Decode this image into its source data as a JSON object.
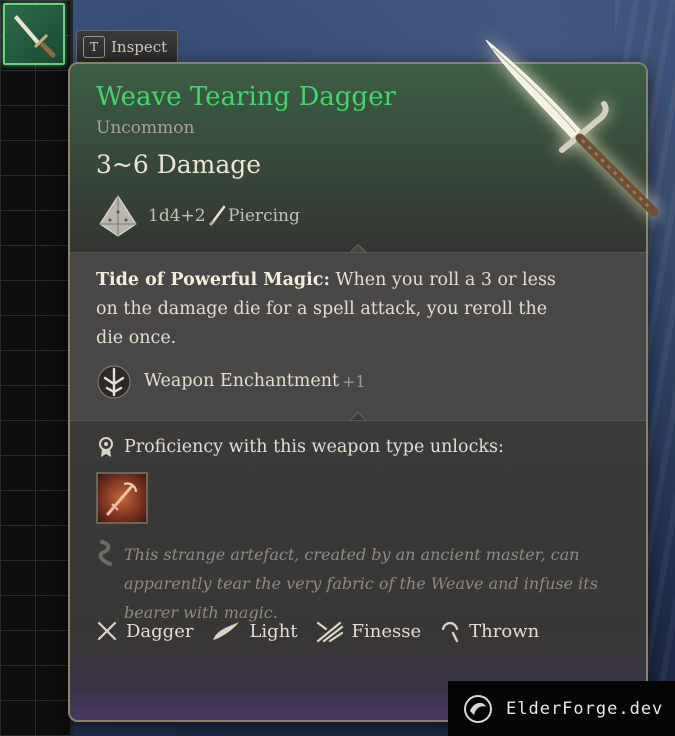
{
  "inspect": {
    "key": "T",
    "label": "Inspect"
  },
  "item": {
    "name": "Weave Tearing Dagger",
    "rarity": "Uncommon",
    "damage": "3~6 Damage",
    "dice": "1d4+2",
    "damage_type": "Piercing",
    "effect_name": "Tide of Powerful Magic:",
    "effect_text": " When you roll a 3 or less on the damage die for a spell attack, you reroll the die once.",
    "enchantment_label": "Weapon Enchantment",
    "enchantment_bonus": "+1",
    "proficiency_text": "Proficiency with this weapon type unlocks:",
    "lore": "This strange artefact, created by an ancient master, can apparently tear the very fabric of the Weave and infuse its bearer with magic.",
    "traits": [
      "Dagger",
      "Light",
      "Finesse",
      "Thrown"
    ]
  },
  "colors": {
    "name": "#3fd86a",
    "uncommon_glow": "#6bd07a"
  },
  "icons": [
    "dagger-slot-icon",
    "dice-icon",
    "piercing-icon",
    "enchantment-icon",
    "proficiency-icon",
    "weapon-action-icon",
    "lore-icon",
    "dagger-trait-icon",
    "light-trait-icon",
    "finesse-trait-icon",
    "thrown-trait-icon",
    "elderforge-logo"
  ],
  "watermark": {
    "text": "ElderForge.dev"
  }
}
